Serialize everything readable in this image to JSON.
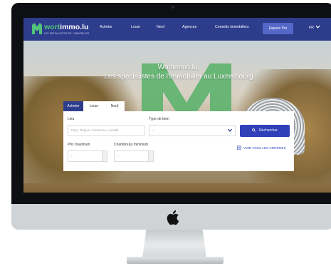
{
  "nav": {
    "brand_wort": "wort",
    "brand_immo": "immo.lu",
    "brand_tagline": "LES SPÉCIALISTES DE L'IMMOBILIER",
    "items": [
      "Acheter",
      "Louer",
      "Neuf",
      "Agences",
      "Conseils immobiliers"
    ],
    "espace_pro": "Espace Pro",
    "language": "FR"
  },
  "hero": {
    "line1": "Wortimmo.lu,",
    "line2": "Les spécialistes de l'immobilier au Luxembourg"
  },
  "search": {
    "tabs": [
      "Acheter",
      "Louer",
      "Neuf"
    ],
    "active_tab": "Acheter",
    "lieu_label": "Lieu",
    "lieu_placeholder": "Pays, Région, Commune, Localité",
    "type_label": "Type de bien",
    "type_value": "-",
    "search_button": "Rechercher",
    "prix_label": "Prix maximum",
    "prix_value": "-",
    "chambres_label": "Chambre(s) minimum",
    "chambres_value": "-",
    "criteria_link": "VOIR TOUS LES CRITÈRES"
  },
  "colors": {
    "nav_bg": "#2e3c8c",
    "accent": "#2f40b8",
    "brand_green": "#52c27a"
  },
  "icons": [
    "apple-logo-icon",
    "chevron-down-icon",
    "search-icon",
    "list-icon"
  ]
}
